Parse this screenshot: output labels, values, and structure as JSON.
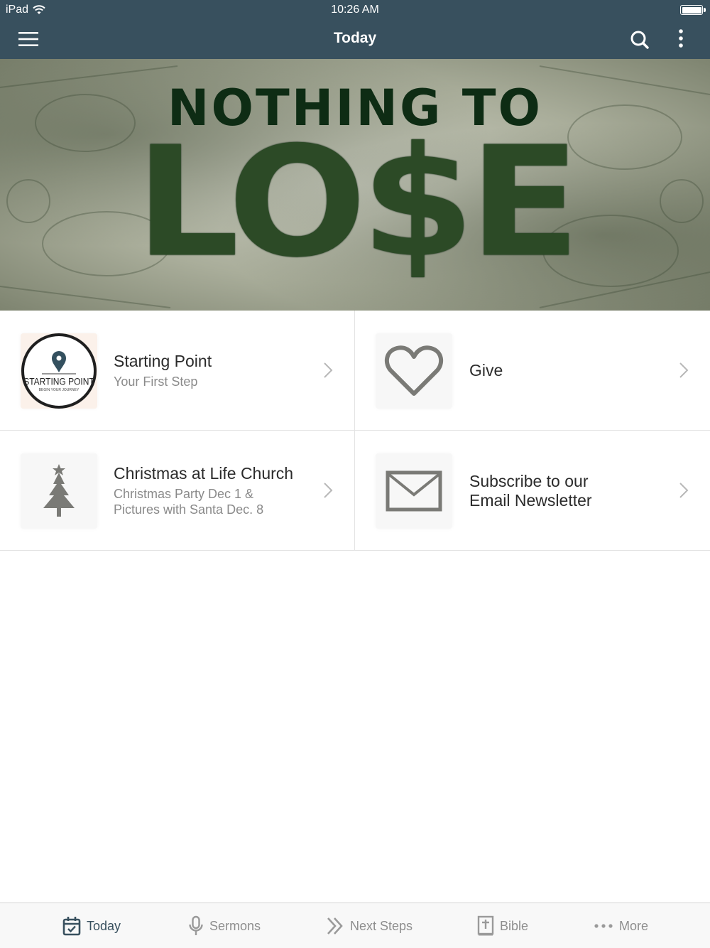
{
  "status_bar": {
    "device": "iPad",
    "time": "10:26 AM"
  },
  "nav": {
    "title": "Today",
    "icons": [
      "menu-icon",
      "search-icon",
      "more-vertical-icon"
    ]
  },
  "hero": {
    "line1": "NOTHING TO",
    "line2": "LO$E"
  },
  "cards": [
    {
      "title": "Starting Point",
      "subtitle": "Your First Step",
      "icon": "location-pin-icon",
      "logo_text": "STARTING POINT",
      "logo_subtext": "BEGIN YOUR JOURNEY"
    },
    {
      "title": "Give",
      "subtitle": "",
      "icon": "heart-icon"
    },
    {
      "title": "Christmas at Life Church",
      "subtitle": "Christmas Party Dec 1 & Pictures with Santa Dec. 8",
      "icon": "christmas-tree-icon"
    },
    {
      "title": "Subscribe to our Email Newsletter",
      "subtitle": "",
      "icon": "envelope-icon"
    }
  ],
  "tabs": [
    {
      "label": "Today",
      "icon": "calendar-check-icon",
      "active": true
    },
    {
      "label": "Sermons",
      "icon": "microphone-icon",
      "active": false
    },
    {
      "label": "Next Steps",
      "icon": "double-chevron-right-icon",
      "active": false
    },
    {
      "label": "Bible",
      "icon": "bible-icon",
      "active": false
    },
    {
      "label": "More",
      "icon": "ellipsis-icon",
      "active": false
    }
  ],
  "colors": {
    "nav_background": "#38505e",
    "active_tab": "#38505e",
    "inactive_tab": "#8e8e8e",
    "hero_text_dark": "#0e2c14"
  }
}
